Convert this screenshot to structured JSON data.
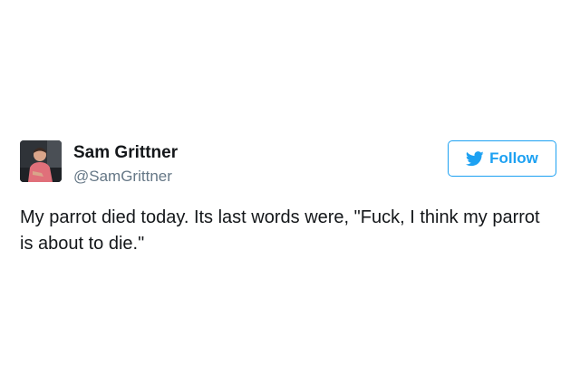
{
  "tweet": {
    "author": {
      "name": "Sam Grittner",
      "handle": "@SamGrittner"
    },
    "follow_label": "Follow",
    "text": "My parrot died today. Its last words were, \"Fuck, I think my parrot is about to die.\""
  },
  "icons": {
    "follow": "twitter-bird-icon",
    "avatar": "profile-photo"
  },
  "colors": {
    "accent": "#1da1f2",
    "text": "#14171a",
    "muted": "#657786"
  }
}
